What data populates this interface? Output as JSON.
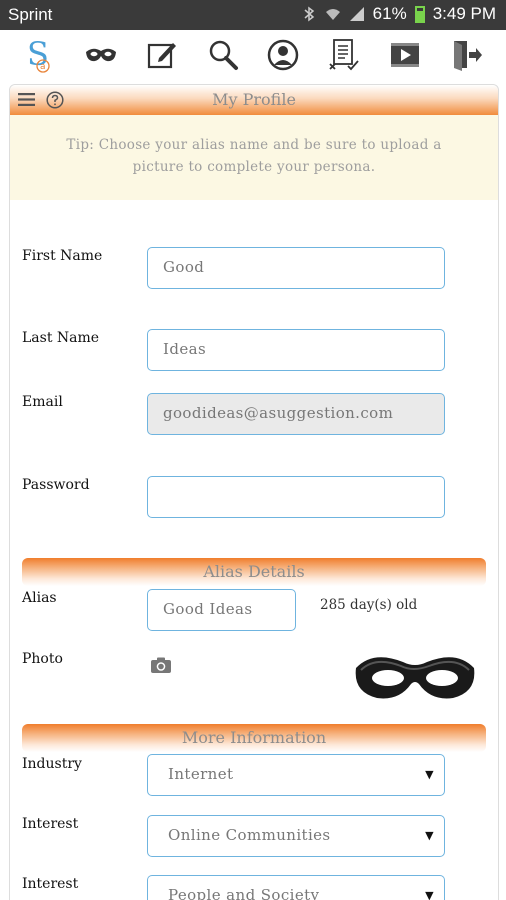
{
  "status": {
    "carrier": "Sprint",
    "battery": "61%",
    "time": "3:49 PM"
  },
  "nav": {
    "icons": [
      "logo-icon",
      "mask-icon",
      "edit-icon",
      "search-icon",
      "profile-icon",
      "checklist-icon",
      "video-icon",
      "logout-icon"
    ],
    "logo_letter_s": "S",
    "logo_letter_a": "a"
  },
  "profile": {
    "title": "My Profile",
    "tip": "Tip: Choose your alias name and be sure to upload a picture to complete your persona."
  },
  "form": {
    "first_name_label": "First Name",
    "first_name_value": "Good",
    "last_name_label": "Last Name",
    "last_name_value": "Ideas",
    "email_label": "Email",
    "email_value": "goodideas@asuggestion.com",
    "password_label": "Password",
    "password_value": ""
  },
  "alias": {
    "section_title": "Alias Details",
    "alias_label": "Alias",
    "alias_value": "Good Ideas",
    "age_text": "285 day(s) old",
    "photo_label": "Photo"
  },
  "more": {
    "section_title": "More Information",
    "industry_label": "Industry",
    "industry_value": "Internet",
    "interest_label_1": "Interest",
    "interest_value_1": "Online Communities",
    "interest_label_2": "Interest",
    "interest_value_2": "People and Society"
  },
  "colors": {
    "accent_orange": "#f18c3c",
    "field_border": "#6fb4df",
    "tip_bg": "#fcf8e3"
  }
}
